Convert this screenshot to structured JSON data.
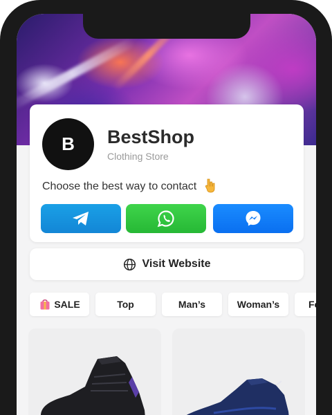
{
  "shop": {
    "avatar_letter": "B",
    "name": "BestShop",
    "category": "Clothing Store",
    "prompt": "Choose the best way to contact",
    "prompt_emoji": "pointing-down-emoji"
  },
  "contact": [
    {
      "id": "telegram",
      "icon": "telegram-icon",
      "color": "#1a96e0"
    },
    {
      "id": "whatsapp",
      "icon": "whatsapp-icon",
      "color": "#2fc23d"
    },
    {
      "id": "messenger",
      "icon": "messenger-icon",
      "color": "#0f7af5"
    }
  ],
  "website": {
    "label": "Visit Website",
    "icon": "globe-icon"
  },
  "categories": [
    {
      "label": "SALE",
      "icon": "shopping-bag-icon"
    },
    {
      "label": "Top"
    },
    {
      "label": "Man’s"
    },
    {
      "label": "Woman’s"
    },
    {
      "label": "Fo"
    }
  ],
  "products": [
    {
      "icon": "black-sneaker-image"
    },
    {
      "icon": "navy-running-shoe-image"
    }
  ]
}
